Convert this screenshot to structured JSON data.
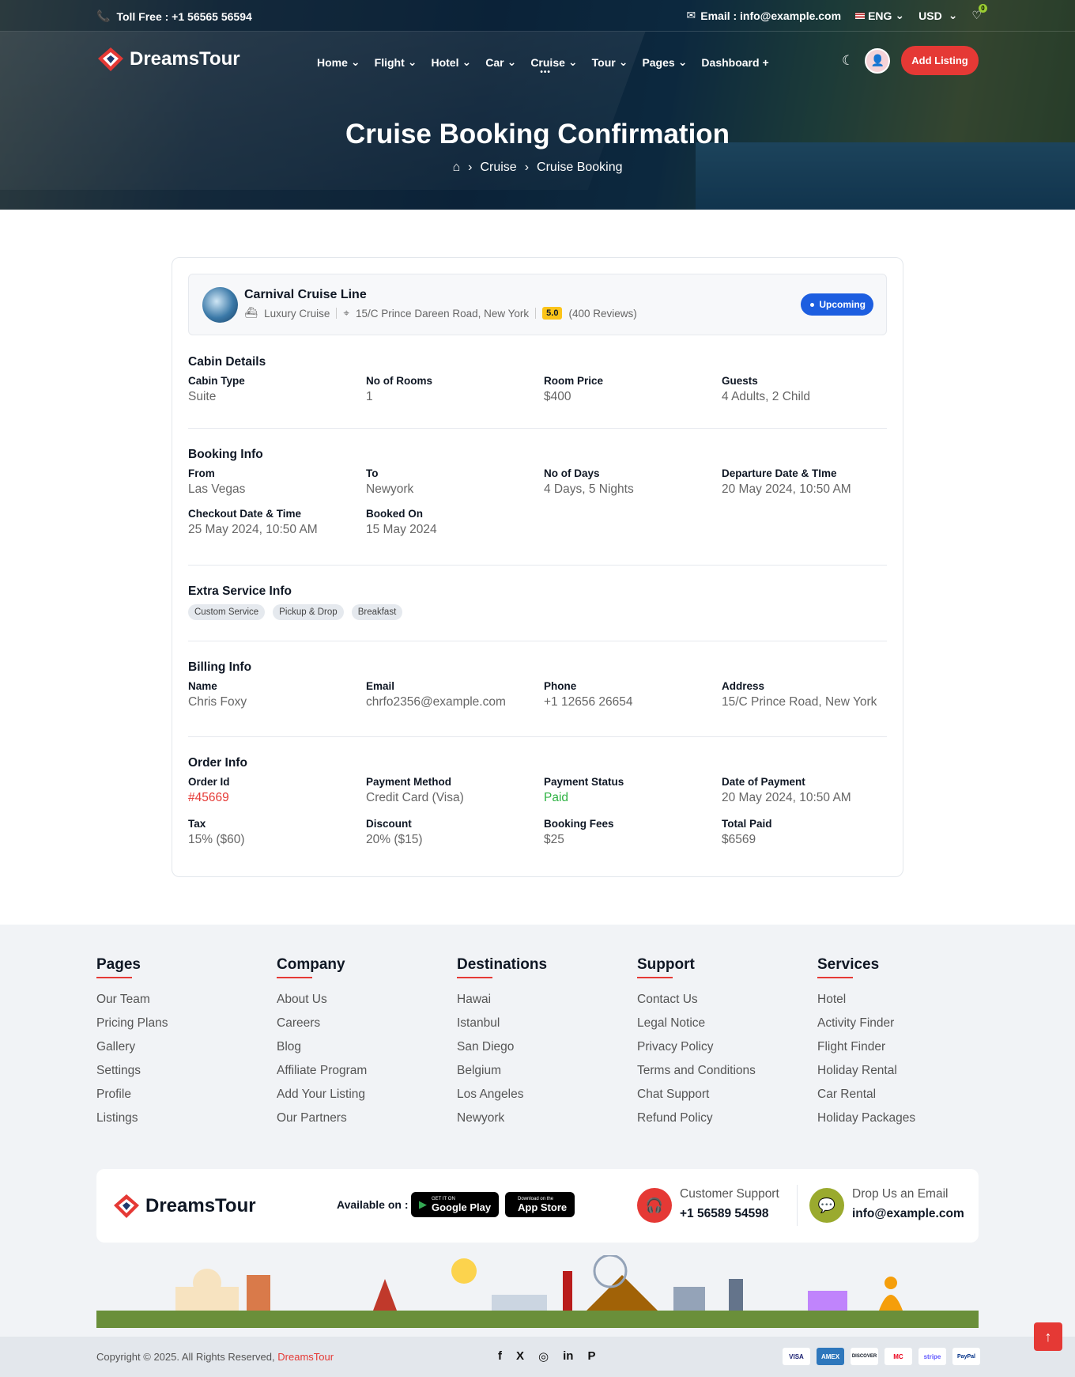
{
  "topbar": {
    "toll_free": "Toll Free : +1 56565 56594",
    "email": "Email : info@example.com",
    "language": "ENG",
    "currency": "USD",
    "wishlist_count": "0"
  },
  "brand": {
    "name": "DreamsTour"
  },
  "nav": {
    "items": [
      {
        "label": "Home"
      },
      {
        "label": "Flight"
      },
      {
        "label": "Hotel"
      },
      {
        "label": "Car"
      },
      {
        "label": "Cruise"
      },
      {
        "label": "Tour"
      },
      {
        "label": "Pages"
      },
      {
        "label": "Dashboard"
      }
    ],
    "add_listing": "Add Listing"
  },
  "hero": {
    "title": "Cruise Booking Confirmation",
    "crumbs": [
      "Cruise",
      "Cruise Booking"
    ]
  },
  "booking": {
    "name": "Carnival Cruise Line",
    "category": "Luxury Cruise",
    "address": "15/C Prince Dareen Road, New York",
    "rating": "5.0",
    "reviews": "(400 Reviews)",
    "status": "Upcoming"
  },
  "cabin": {
    "title": "Cabin Details",
    "fields": [
      {
        "label": "Cabin Type",
        "value": "Suite"
      },
      {
        "label": "No of Rooms",
        "value": "1"
      },
      {
        "label": "Room Price",
        "value": "$400"
      },
      {
        "label": "Guests",
        "value": "4 Adults, 2 Child"
      }
    ]
  },
  "booking_info": {
    "title": "Booking Info",
    "fields": [
      {
        "label": "From",
        "value": "Las Vegas"
      },
      {
        "label": "To",
        "value": "Newyork"
      },
      {
        "label": "No of Days",
        "value": "4 Days, 5 Nights"
      },
      {
        "label": "Departure Date & TIme",
        "value": "20 May 2024, 10:50 AM"
      },
      {
        "label": "Checkout Date & Time",
        "value": "25 May 2024, 10:50 AM"
      },
      {
        "label": "Booked On",
        "value": "15 May 2024"
      }
    ]
  },
  "extra": {
    "title": "Extra Service Info",
    "chips": [
      "Custom Service",
      "Pickup & Drop",
      "Breakfast"
    ]
  },
  "billing": {
    "title": "Billing Info",
    "fields": [
      {
        "label": "Name",
        "value": "Chris Foxy"
      },
      {
        "label": "Email",
        "value": "chrfo2356@example.com"
      },
      {
        "label": "Phone",
        "value": "+1 12656 26654"
      },
      {
        "label": "Address",
        "value": "15/C Prince Road, New York"
      }
    ]
  },
  "order": {
    "title": "Order Info",
    "fields": [
      {
        "label": "Order Id",
        "value": "#45669",
        "color": "#e53935"
      },
      {
        "label": "Payment Method",
        "value": "Credit Card (Visa)"
      },
      {
        "label": "Payment Status",
        "value": "Paid",
        "color": "#2fb344"
      },
      {
        "label": "Date of Payment",
        "value": "20 May 2024, 10:50 AM"
      },
      {
        "label": "Tax",
        "value": "15% ($60)"
      },
      {
        "label": "Discount",
        "value": "20% ($15)"
      },
      {
        "label": "Booking Fees",
        "value": "$25"
      },
      {
        "label": "Total Paid",
        "value": "$6569"
      }
    ]
  },
  "footer": {
    "columns": [
      {
        "title": "Pages",
        "links": [
          "Our Team",
          "Pricing Plans",
          "Gallery",
          "Settings",
          "Profile",
          "Listings"
        ]
      },
      {
        "title": "Company",
        "links": [
          "About Us",
          "Careers",
          "Blog",
          "Affiliate Program",
          "Add Your Listing",
          "Our Partners"
        ]
      },
      {
        "title": "Destinations",
        "links": [
          "Hawai",
          "Istanbul",
          "San Diego",
          "Belgium",
          "Los Angeles",
          "Newyork"
        ]
      },
      {
        "title": "Support",
        "links": [
          "Contact Us",
          "Legal Notice",
          "Privacy Policy",
          "Terms and Conditions",
          "Chat Support",
          "Refund Policy"
        ]
      },
      {
        "title": "Services",
        "links": [
          "Hotel",
          "Activity Finder",
          "Flight Finder",
          "Holiday Rental",
          "Car Rental",
          "Holiday Packages"
        ]
      }
    ],
    "available_on": "Available on :",
    "google_play": {
      "small": "GET IT ON",
      "big": "Google Play"
    },
    "app_store": {
      "small": "Download on the",
      "big": "App Store"
    },
    "support_label": "Customer Support",
    "support_phone": "+1 56589 54598",
    "email_label": "Drop Us an Email",
    "email_value": "info@example.com",
    "copyright": "Copyright © 2025. All Rights Reserved,",
    "copyright_brand": "DreamsTour",
    "social": [
      "f",
      "X",
      "◎",
      "in",
      "P"
    ],
    "payments": [
      "VISA",
      "AMEX",
      "DISCOVER",
      "MC",
      "stripe",
      "PayPal"
    ]
  },
  "colors": {
    "accent": "#e53935",
    "primary": "#1d5ee0",
    "success": "#2fb344"
  }
}
